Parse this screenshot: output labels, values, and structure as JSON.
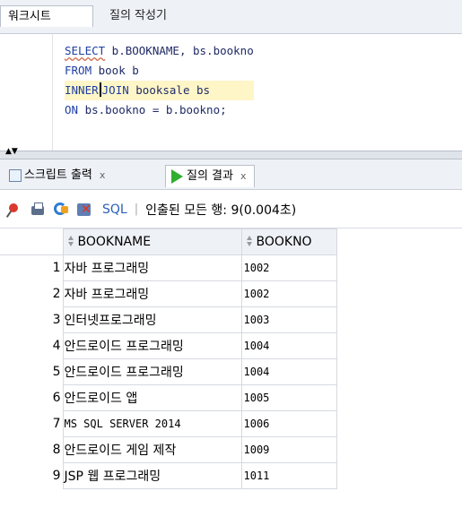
{
  "top_tabs": {
    "worksheet": "워크시트",
    "query_builder": "질의 작성기"
  },
  "editor": {
    "lines": [
      {
        "kw": "SELECT",
        "rest": " b.BOOKNAME, bs.bookno"
      },
      {
        "kw": "FROM",
        "rest": " book b"
      },
      {
        "kw1": "INNER",
        "kw2": "JOIN",
        "rest": " booksale bs"
      },
      {
        "kw": "ON",
        "rest": " bs.bookno = b.bookno;"
      }
    ]
  },
  "bottom_tabs": {
    "script_output": "스크립트 출력",
    "query_result": "질의 결과",
    "close_glyph": "x"
  },
  "toolbar": {
    "sql_label": "SQL",
    "separator": "|",
    "status": "인출된 모든 행: 9(0.004초)"
  },
  "grid": {
    "columns": [
      "BOOKNAME",
      "BOOKNO"
    ],
    "rows": [
      {
        "num": "1",
        "name": "자바 프로그래밍",
        "no": "1002"
      },
      {
        "num": "2",
        "name": "자바 프로그래밍",
        "no": "1002"
      },
      {
        "num": "3",
        "name": "인터넷프로그래밍",
        "no": "1003"
      },
      {
        "num": "4",
        "name": "안드로이드 프로그래밍",
        "no": "1004"
      },
      {
        "num": "5",
        "name": "안드로이드 프로그래밍",
        "no": "1004"
      },
      {
        "num": "6",
        "name": "안드로이드 앱",
        "no": "1005"
      },
      {
        "num": "7",
        "name": "MS SQL SERVER 2014",
        "no": "1006"
      },
      {
        "num": "8",
        "name": "안드로이드 게임 제작",
        "no": "1009"
      },
      {
        "num": "9",
        "name": "JSP 웹 프로그래밍",
        "no": "1011"
      }
    ]
  },
  "icons": {
    "pin": "pin-icon",
    "print": "print-icon",
    "refresh": "refresh-icon",
    "cancel": "cancel-icon",
    "play": "play-icon",
    "doc": "script-output-icon"
  },
  "colors": {
    "keyword": "#1f3fa3",
    "sql_link": "#2a5fb8",
    "run_green": "#2fae2f",
    "tab_bar": "#eef1f6"
  }
}
